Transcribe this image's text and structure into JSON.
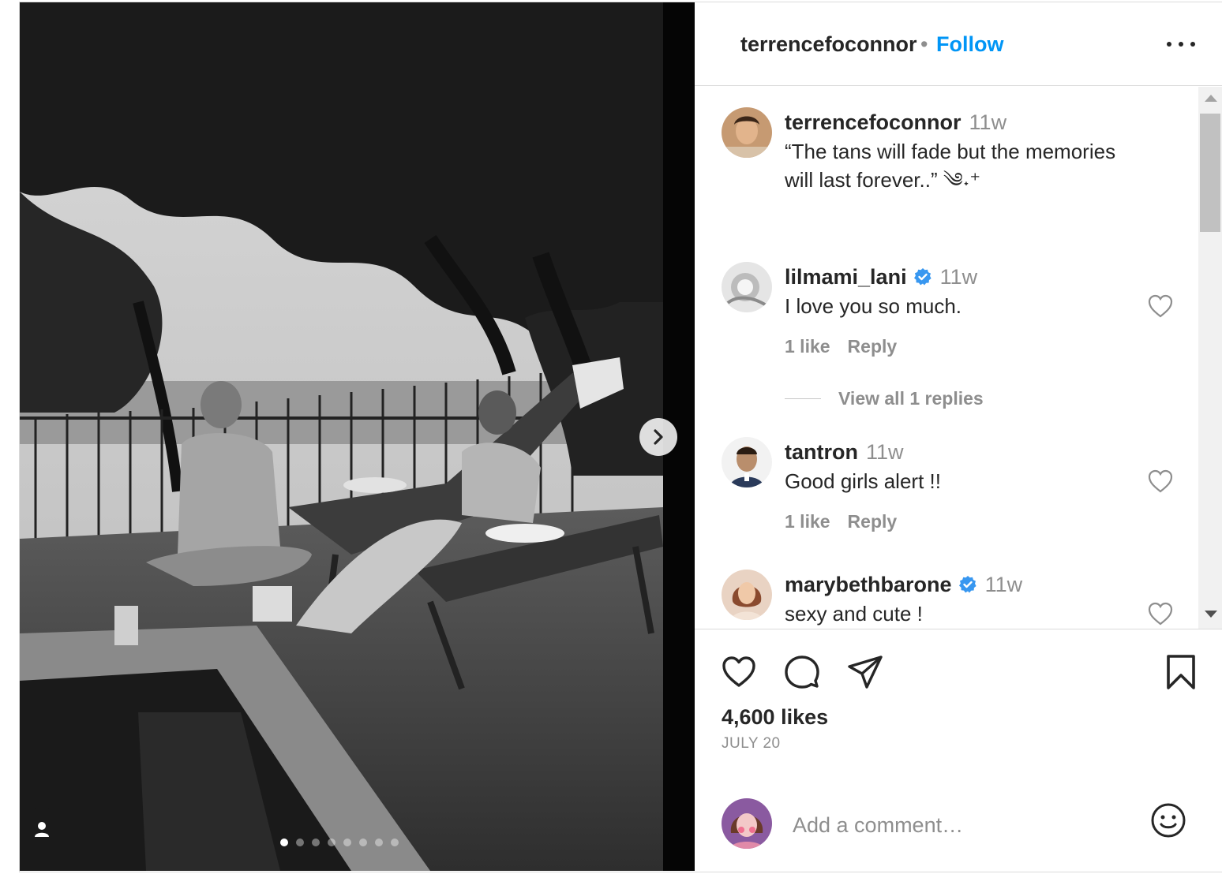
{
  "header": {
    "username": "terrencefoconnor",
    "separator": "•",
    "follow_label": "Follow"
  },
  "caption": {
    "username": "terrencefoconnor",
    "time": "11w",
    "text_line1": "“The tans will fade but the memories",
    "text_line2": "will last forever..” ༄˖⁺"
  },
  "comments": [
    {
      "username": "lilmami_lani",
      "verified": true,
      "time": "11w",
      "text": "I love you so much.",
      "likes_label": "1 like",
      "reply_label": "Reply",
      "view_replies": "View all 1 replies"
    },
    {
      "username": "tantron",
      "verified": false,
      "time": "11w",
      "text": "Good girls alert !!",
      "likes_label": "1 like",
      "reply_label": "Reply"
    },
    {
      "username": "marybethbarone",
      "verified": true,
      "time": "11w",
      "text": "sexy and cute !"
    }
  ],
  "footer": {
    "likes": "4,600 likes",
    "date": "JULY 20",
    "add_comment_placeholder": "Add a comment…"
  },
  "icons": {
    "like": "heart-icon",
    "comment": "comment-icon",
    "share": "send-icon",
    "save": "bookmark-icon",
    "emoji": "emoji-icon",
    "next": "chevron-right-icon",
    "tag": "user-tag-icon",
    "verified": "verified-badge-icon"
  },
  "colors": {
    "accent": "#0095f6",
    "verified": "#3897f0",
    "text": "#262626",
    "muted": "#8e8e8e"
  },
  "carousel": {
    "slide_count": 8,
    "active_index": 0
  }
}
